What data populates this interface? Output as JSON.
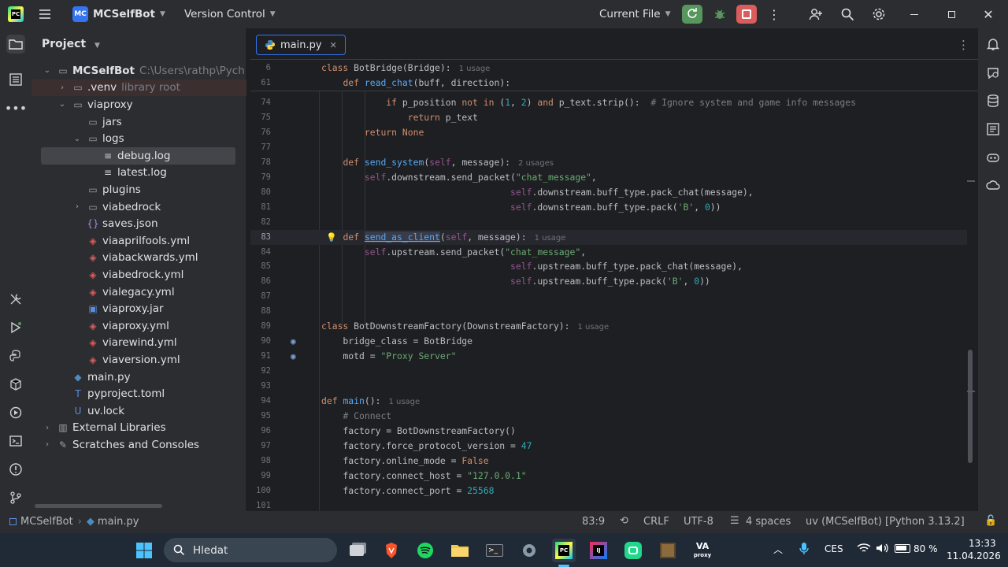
{
  "titlebar": {
    "project_badge": "MC",
    "project_name": "MCSelfBot",
    "vcs": "Version Control",
    "run_config": "Current File"
  },
  "project_panel": {
    "title": "Project",
    "items": [
      {
        "label": "MCSelfBot",
        "hint": "C:\\Users\\rathp\\Pych",
        "indent": 0,
        "arrow": "open",
        "icon": "folder-icon"
      },
      {
        "label": ".venv",
        "hint": "library root",
        "indent": 1,
        "arrow": "closed",
        "icon": "folder-icon"
      },
      {
        "label": "viaproxy",
        "indent": 1,
        "arrow": "open",
        "icon": "folder-icon"
      },
      {
        "label": "jars",
        "indent": 2,
        "arrow": "",
        "icon": "folder-icon"
      },
      {
        "label": "logs",
        "indent": 2,
        "arrow": "open",
        "icon": "folder-icon"
      },
      {
        "label": "debug.log",
        "indent": 3,
        "arrow": "",
        "icon": "text-file-icon",
        "selected": true
      },
      {
        "label": "latest.log",
        "indent": 3,
        "arrow": "",
        "icon": "text-file-icon"
      },
      {
        "label": "plugins",
        "indent": 2,
        "arrow": "",
        "icon": "folder-icon"
      },
      {
        "label": "viabedrock",
        "indent": 2,
        "arrow": "closed",
        "icon": "folder-icon"
      },
      {
        "label": "saves.json",
        "indent": 2,
        "arrow": "",
        "icon": "json-file-icon"
      },
      {
        "label": "viaaprilfools.yml",
        "indent": 2,
        "arrow": "",
        "icon": "yaml-file-icon"
      },
      {
        "label": "viabackwards.yml",
        "indent": 2,
        "arrow": "",
        "icon": "yaml-file-icon"
      },
      {
        "label": "viabedrock.yml",
        "indent": 2,
        "arrow": "",
        "icon": "yaml-file-icon"
      },
      {
        "label": "vialegacy.yml",
        "indent": 2,
        "arrow": "",
        "icon": "yaml-file-icon"
      },
      {
        "label": "viaproxy.jar",
        "indent": 2,
        "arrow": "",
        "icon": "jar-file-icon"
      },
      {
        "label": "viaproxy.yml",
        "indent": 2,
        "arrow": "",
        "icon": "yaml-file-icon"
      },
      {
        "label": "viarewind.yml",
        "indent": 2,
        "arrow": "",
        "icon": "yaml-file-icon"
      },
      {
        "label": "viaversion.yml",
        "indent": 2,
        "arrow": "",
        "icon": "yaml-file-icon"
      },
      {
        "label": "main.py",
        "indent": 1,
        "arrow": "",
        "icon": "python-file-icon"
      },
      {
        "label": "pyproject.toml",
        "indent": 1,
        "arrow": "",
        "icon": "toml-file-icon"
      },
      {
        "label": "uv.lock",
        "indent": 1,
        "arrow": "",
        "icon": "lock-file-icon"
      },
      {
        "label": "External Libraries",
        "indent": 0,
        "arrow": "closed",
        "icon": "library-icon"
      },
      {
        "label": "Scratches and Consoles",
        "indent": 0,
        "arrow": "closed",
        "icon": "scratches-icon"
      }
    ]
  },
  "editor": {
    "tab_label": "main.py",
    "sticky": [
      {
        "ln": "6",
        "code": [
          [
            "kw",
            "class "
          ],
          [
            "tx",
            "BotBridge(Bridge):"
          ],
          [
            "hint",
            "1 usage"
          ]
        ]
      },
      {
        "ln": "61",
        "code": [
          [
            "tx",
            "    "
          ],
          [
            "kw",
            "def "
          ],
          [
            "fn",
            "read_chat"
          ],
          [
            "tx",
            "(buff, direction):"
          ]
        ]
      }
    ],
    "lines": [
      {
        "ln": "74",
        "code": [
          [
            "tx",
            "            "
          ],
          [
            "kw",
            "if "
          ],
          [
            "tx",
            "p_position "
          ],
          [
            "kw",
            "not in "
          ],
          [
            "tx",
            "("
          ],
          [
            "nu",
            "1"
          ],
          [
            "tx",
            ", "
          ],
          [
            "nu",
            "2"
          ],
          [
            "tx",
            ") "
          ],
          [
            "kw",
            "and "
          ],
          [
            "tx",
            "p_text.strip():  "
          ],
          [
            "cm",
            "# Ignore system and game info messages"
          ]
        ]
      },
      {
        "ln": "75",
        "code": [
          [
            "tx",
            "                "
          ],
          [
            "kw",
            "return "
          ],
          [
            "tx",
            "p_text"
          ]
        ]
      },
      {
        "ln": "76",
        "code": [
          [
            "tx",
            "        "
          ],
          [
            "kw",
            "return "
          ],
          [
            "kw",
            "None"
          ]
        ]
      },
      {
        "ln": "77",
        "code": []
      },
      {
        "ln": "78",
        "code": [
          [
            "tx",
            "    "
          ],
          [
            "kw",
            "def "
          ],
          [
            "fn",
            "send_system"
          ],
          [
            "tx",
            "("
          ],
          [
            "sf",
            "self"
          ],
          [
            "tx",
            ", message):"
          ],
          [
            "hint",
            "2 usages"
          ]
        ]
      },
      {
        "ln": "79",
        "code": [
          [
            "tx",
            "        "
          ],
          [
            "sf",
            "self"
          ],
          [
            "tx",
            ".downstream.send_packet("
          ],
          [
            "st",
            "\"chat_message\""
          ],
          [
            "tx",
            ","
          ]
        ]
      },
      {
        "ln": "80",
        "code": [
          [
            "tx",
            "                                   "
          ],
          [
            "sf",
            "self"
          ],
          [
            "tx",
            ".downstream.buff_type.pack_chat(message),"
          ]
        ]
      },
      {
        "ln": "81",
        "code": [
          [
            "tx",
            "                                   "
          ],
          [
            "sf",
            "self"
          ],
          [
            "tx",
            ".downstream.buff_type.pack("
          ],
          [
            "st",
            "'B'"
          ],
          [
            "tx",
            ", "
          ],
          [
            "nu",
            "0"
          ],
          [
            "tx",
            "))"
          ]
        ]
      },
      {
        "ln": "82",
        "code": []
      },
      {
        "ln": "83",
        "code": [
          [
            "tx",
            "    "
          ],
          [
            "kw",
            "def "
          ],
          [
            "fnh",
            "send_as_client"
          ],
          [
            "tx",
            "("
          ],
          [
            "sf",
            "self"
          ],
          [
            "tx",
            ", message):"
          ],
          [
            "hint",
            "1 usage"
          ]
        ],
        "current": true,
        "bulb": true
      },
      {
        "ln": "84",
        "code": [
          [
            "tx",
            "        "
          ],
          [
            "sf",
            "self"
          ],
          [
            "tx",
            ".upstream.send_packet("
          ],
          [
            "st",
            "\"chat_message\""
          ],
          [
            "tx",
            ","
          ]
        ]
      },
      {
        "ln": "85",
        "code": [
          [
            "tx",
            "                                   "
          ],
          [
            "sf",
            "self"
          ],
          [
            "tx",
            ".upstream.buff_type.pack_chat(message),"
          ]
        ]
      },
      {
        "ln": "86",
        "code": [
          [
            "tx",
            "                                   "
          ],
          [
            "sf",
            "self"
          ],
          [
            "tx",
            ".upstream.buff_type.pack("
          ],
          [
            "st",
            "'B'"
          ],
          [
            "tx",
            ", "
          ],
          [
            "nu",
            "0"
          ],
          [
            "tx",
            "))"
          ]
        ]
      },
      {
        "ln": "87",
        "code": []
      },
      {
        "ln": "88",
        "code": []
      },
      {
        "ln": "89",
        "code": [
          [
            "kw",
            "class "
          ],
          [
            "tx",
            "BotDownstreamFactory(DownstreamFactory):"
          ],
          [
            "hint",
            "1 usage"
          ]
        ]
      },
      {
        "ln": "90",
        "code": [
          [
            "tx",
            "    bridge_class = BotBridge"
          ]
        ],
        "override": true
      },
      {
        "ln": "91",
        "code": [
          [
            "tx",
            "    motd = "
          ],
          [
            "st",
            "\"Proxy Server\""
          ]
        ],
        "override": true
      },
      {
        "ln": "92",
        "code": []
      },
      {
        "ln": "93",
        "code": []
      },
      {
        "ln": "94",
        "code": [
          [
            "kw",
            "def "
          ],
          [
            "fn",
            "main"
          ],
          [
            "tx",
            "():"
          ],
          [
            "hint",
            "1 usage"
          ]
        ]
      },
      {
        "ln": "95",
        "code": [
          [
            "tx",
            "    "
          ],
          [
            "cm",
            "# Connect"
          ]
        ]
      },
      {
        "ln": "96",
        "code": [
          [
            "tx",
            "    factory = BotDownstreamFactory()"
          ]
        ]
      },
      {
        "ln": "97",
        "code": [
          [
            "tx",
            "    factory.force_protocol_version = "
          ],
          [
            "nu",
            "47"
          ]
        ]
      },
      {
        "ln": "98",
        "code": [
          [
            "tx",
            "    factory.online_mode = "
          ],
          [
            "kw",
            "False"
          ]
        ]
      },
      {
        "ln": "99",
        "code": [
          [
            "tx",
            "    factory.connect_host = "
          ],
          [
            "st",
            "\"127.0.0.1\""
          ]
        ]
      },
      {
        "ln": "100",
        "code": [
          [
            "tx",
            "    factory.connect_port = "
          ],
          [
            "nu",
            "25568"
          ]
        ]
      },
      {
        "ln": "101",
        "code": []
      }
    ]
  },
  "statusbar": {
    "crumb_project": "MCSelfBot",
    "crumb_file": "main.py",
    "position": "83:9",
    "line_sep": "CRLF",
    "encoding": "UTF-8",
    "indent": "4 spaces",
    "interpreter": "uv (MCSelfBot) [Python 3.13.2]"
  },
  "taskbar": {
    "search_placeholder": "Hledat",
    "lang": "CES",
    "battery": "80 %",
    "time": "13:33",
    "date": "11.04.2026"
  },
  "colors": {
    "accent": "#3574f0",
    "run_green": "#57965c",
    "stop_red": "#db5c5c"
  }
}
